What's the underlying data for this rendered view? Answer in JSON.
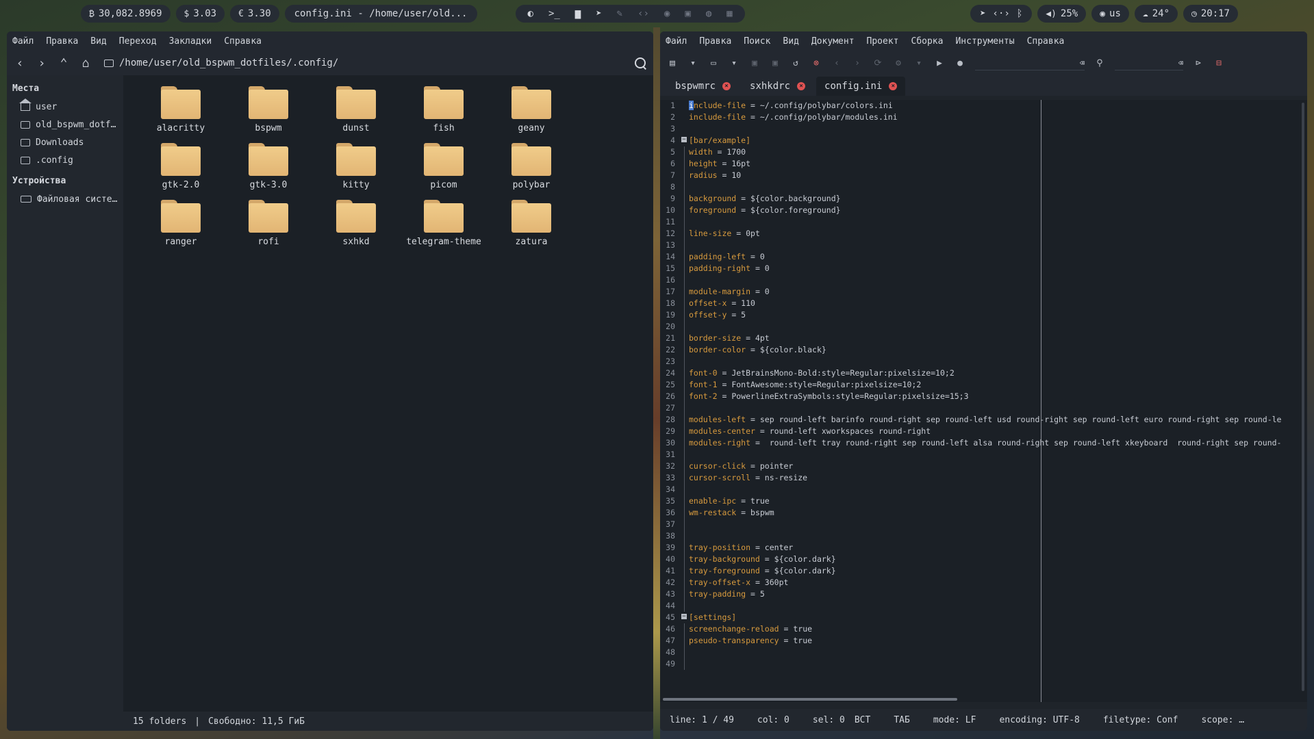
{
  "topbar": {
    "btc": "30,082.8969",
    "usd": "3.03",
    "eur": "3.30",
    "window_title": "config.ini - /home/user/old...",
    "tray_icons": [
      "firefox-icon",
      "terminal-icon",
      "folder-icon",
      "telegram-icon",
      "brush-icon",
      "code-icon",
      "github-icon",
      "app-icon",
      "settings-icon",
      "calculator-icon"
    ],
    "volume": "25%",
    "layout": "us",
    "weather": "24°",
    "time": "20:17"
  },
  "file_manager": {
    "menu": [
      "Файл",
      "Правка",
      "Вид",
      "Переход",
      "Закладки",
      "Справка"
    ],
    "path": "/home/user/old_bspwm_dotfiles/.config/",
    "sidebar": {
      "places_title": "Места",
      "places": [
        "user",
        "old_bspwm_dotf…",
        "Downloads",
        ".config"
      ],
      "devices_title": "Устройства",
      "devices": [
        "Файловая систе…"
      ]
    },
    "folders": [
      "alacritty",
      "bspwm",
      "dunst",
      "fish",
      "geany",
      "gtk-2.0",
      "gtk-3.0",
      "kitty",
      "picom",
      "polybar",
      "ranger",
      "rofi",
      "sxhkd",
      "telegram-theme",
      "zatura"
    ],
    "status_count": "15 folders",
    "status_sep": "|",
    "status_free": "Свободно: 11,5 ГиБ"
  },
  "editor": {
    "menu": [
      "Файл",
      "Правка",
      "Поиск",
      "Вид",
      "Документ",
      "Проект",
      "Сборка",
      "Инструменты",
      "Справка"
    ],
    "tabs": [
      "bspwmrc",
      "sxhkdrc",
      "config.ini"
    ],
    "active_tab": "config.ini",
    "lines": [
      "include-file = ~/.config/polybar/colors.ini",
      "include-file = ~/.config/polybar/modules.ini",
      "",
      "[bar/example]",
      "width = 1700",
      "height = 16pt",
      "radius = 10",
      "",
      "background = ${color.background}",
      "foreground = ${color.foreground}",
      "",
      "line-size = 0pt",
      "",
      "padding-left = 0",
      "padding-right = 0",
      "",
      "module-margin = 0",
      "offset-x = 110",
      "offset-y = 5",
      "",
      "border-size = 4pt",
      "border-color = ${color.black}",
      "",
      "font-0 = JetBrainsMono-Bold:style=Regular:pixelsize=10;2",
      "font-1 = FontAwesome:style=Regular:pixelsize=10;2",
      "font-2 = PowerlineExtraSymbols:style=Regular:pixelsize=15;3",
      "",
      "modules-left = sep round-left barinfo round-right sep round-left usd round-right sep round-left euro round-right sep round-le",
      "modules-center = round-left xworkspaces round-right",
      "modules-right =  round-left tray round-right sep round-left alsa round-right sep round-left xkeyboard  round-right sep round-",
      "",
      "cursor-click = pointer",
      "cursor-scroll = ns-resize",
      "",
      "enable-ipc = true",
      "wm-restack = bspwm",
      "",
      "",
      "tray-position = center",
      "tray-background = ${color.dark}",
      "tray-foreground = ${color.dark}",
      "tray-offset-x = 360pt",
      "tray-padding = 5",
      "",
      "[settings]",
      "screenchange-reload = true",
      "pseudo-transparency = true",
      "",
      ""
    ],
    "status": {
      "line": "line: 1 / 49",
      "col": "col: 0",
      "sel": "sel: 0",
      "ins": "ВСТ",
      "tab": "ТАБ",
      "mode": "mode: LF",
      "encoding": "encoding: UTF-8",
      "filetype": "filetype: Conf",
      "scope": "scope: …"
    }
  },
  "colors": {
    "accent_key": "#d79a3e",
    "folder": "#e2b574",
    "tab_close": "#e05252"
  }
}
